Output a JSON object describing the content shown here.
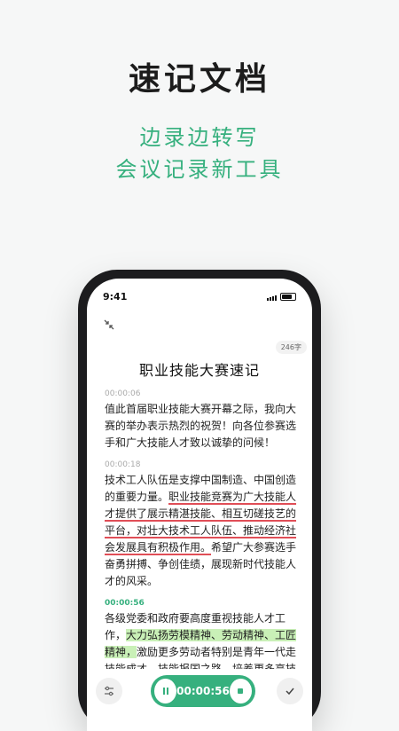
{
  "hero": {
    "title": "速记文档",
    "subtitle_line1": "边录边转写",
    "subtitle_line2": "会议记录新工具"
  },
  "status_bar": {
    "time": "9:41"
  },
  "document": {
    "word_count": "246字",
    "title": "职业技能大赛速记",
    "segments": [
      {
        "timestamp": "00:00:06",
        "text": "值此首届职业技能大赛开幕之际，我向大赛的举办表示热烈的祝贺！向各位参赛选手和广大技能人才致以诚挚的问候！"
      },
      {
        "timestamp": "00:00:18",
        "text_before": "技术工人队伍是支撑中国制造、中国创造的重要力量。",
        "text_underlined": "职业技能竞赛为广大技能人才提供了展示精湛技能、相互切磋技艺的平台，对壮大技术工人队伍、推动经济社会发展具有积极作用。",
        "text_after": "希望广大参赛选手奋勇拼搏、争创佳绩，展现新时代技能人才的风采。"
      },
      {
        "timestamp": "00:00:56",
        "text_before": "各级党委和政府要高度重视技能人才工作，",
        "text_highlighted": "大力弘扬劳模精神、劳动精神、工匠精神，",
        "text_after": "激励更多劳动者特别是青年一代走技能成才、技能报国之路，培养更多高技能人才和大国工匠，为全面建设社会主义现代化国家提供有力人才保障"
      }
    ]
  },
  "recorder": {
    "elapsed": "00:00:56"
  },
  "colors": {
    "accent": "#36b07e",
    "underline": "#e04e57",
    "highlight": "#c9f0b7"
  },
  "icons": {
    "collapse": "collapse-arrows-icon",
    "settings": "sliders-icon",
    "pause": "pause-icon",
    "stop": "stop-icon",
    "done": "checkmark-icon"
  }
}
